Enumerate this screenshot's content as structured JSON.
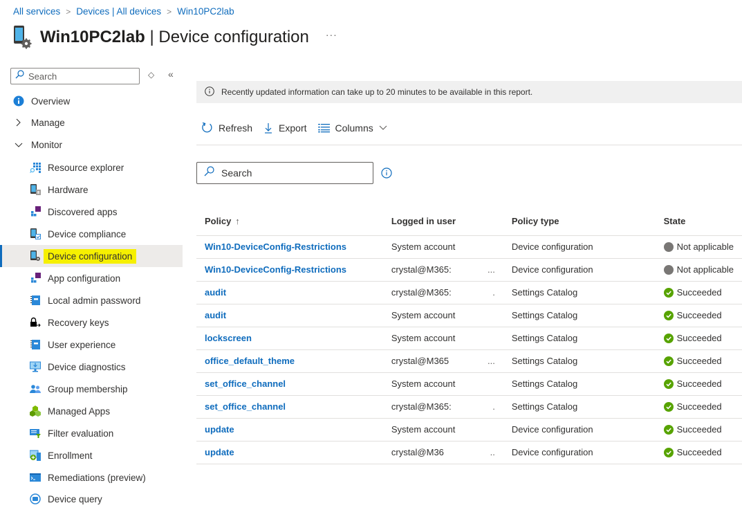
{
  "breadcrumb": [
    {
      "label": "All services"
    },
    {
      "label": "Devices | All devices"
    },
    {
      "label": "Win10PC2lab"
    }
  ],
  "header": {
    "device_name": "Win10PC2lab",
    "separator": " | ",
    "section": "Device configuration",
    "more_label": "···"
  },
  "sidebar": {
    "search_placeholder": "Search",
    "sort_icon": "◇",
    "collapse_icon": "«",
    "items": [
      {
        "label": "Overview",
        "icon": "info-icon",
        "level": "top"
      },
      {
        "label": "Manage",
        "icon": "chevron-right-icon",
        "level": "top"
      },
      {
        "label": "Monitor",
        "icon": "chevron-down-icon",
        "level": "top"
      },
      {
        "label": "Resource explorer",
        "icon": "resource-explorer-icon",
        "level": "sub"
      },
      {
        "label": "Hardware",
        "icon": "hardware-icon",
        "level": "sub"
      },
      {
        "label": "Discovered apps",
        "icon": "discovered-apps-icon",
        "level": "sub"
      },
      {
        "label": "Device compliance",
        "icon": "device-compliance-icon",
        "level": "sub"
      },
      {
        "label": "Device configuration",
        "icon": "device-configuration-icon",
        "level": "sub",
        "active": true
      },
      {
        "label": "App configuration",
        "icon": "app-configuration-icon",
        "level": "sub"
      },
      {
        "label": "Local admin password",
        "icon": "local-admin-password-icon",
        "level": "sub"
      },
      {
        "label": "Recovery keys",
        "icon": "recovery-keys-icon",
        "level": "sub"
      },
      {
        "label": "User experience",
        "icon": "user-experience-icon",
        "level": "sub"
      },
      {
        "label": "Device diagnostics",
        "icon": "device-diagnostics-icon",
        "level": "sub"
      },
      {
        "label": "Group membership",
        "icon": "group-membership-icon",
        "level": "sub"
      },
      {
        "label": "Managed Apps",
        "icon": "managed-apps-icon",
        "level": "sub"
      },
      {
        "label": "Filter evaluation",
        "icon": "filter-evaluation-icon",
        "level": "sub"
      },
      {
        "label": "Enrollment",
        "icon": "enrollment-icon",
        "level": "sub"
      },
      {
        "label": "Remediations (preview)",
        "icon": "remediations-icon",
        "level": "sub"
      },
      {
        "label": "Device query",
        "icon": "device-query-icon",
        "level": "sub"
      }
    ]
  },
  "main": {
    "info_message": "Recently updated information can take up to 20 minutes to be available in this report.",
    "toolbar": {
      "refresh_label": "Refresh",
      "export_label": "Export",
      "columns_label": "Columns"
    },
    "search_placeholder": "Search",
    "table": {
      "columns": [
        "Policy",
        "Logged in user",
        "Policy type",
        "State"
      ],
      "sort_indicator": "↑",
      "rows": [
        {
          "policy": "Win10-DeviceConfig-Restrictions",
          "user": "System account",
          "user_ellipsis": "",
          "type": "Device configuration",
          "state": "Not applicable",
          "status": "na"
        },
        {
          "policy": "Win10-DeviceConfig-Restrictions",
          "user": "crystal@M365:",
          "user_ellipsis": "...",
          "type": "Device configuration",
          "state": "Not applicable",
          "status": "na"
        },
        {
          "policy": "audit",
          "user": "crystal@M365:",
          "user_ellipsis": ".",
          "type": "Settings Catalog",
          "state": "Succeeded",
          "status": "ok"
        },
        {
          "policy": "audit",
          "user": "System account",
          "user_ellipsis": "",
          "type": "Settings Catalog",
          "state": "Succeeded",
          "status": "ok"
        },
        {
          "policy": "lockscreen",
          "user": "System account",
          "user_ellipsis": "",
          "type": "Settings Catalog",
          "state": "Succeeded",
          "status": "ok"
        },
        {
          "policy": "office_default_theme",
          "user": "crystal@M365",
          "user_ellipsis": "...",
          "type": "Settings Catalog",
          "state": "Succeeded",
          "status": "ok"
        },
        {
          "policy": "set_office_channel",
          "user": "System account",
          "user_ellipsis": "",
          "type": "Settings Catalog",
          "state": "Succeeded",
          "status": "ok"
        },
        {
          "policy": "set_office_channel",
          "user": "crystal@M365:",
          "user_ellipsis": ".",
          "type": "Settings Catalog",
          "state": "Succeeded",
          "status": "ok"
        },
        {
          "policy": "update",
          "user": "System account",
          "user_ellipsis": "",
          "type": "Device configuration",
          "state": "Succeeded",
          "status": "ok"
        },
        {
          "policy": "update",
          "user": "crystal@M36",
          "user_ellipsis": "..",
          "type": "Device configuration",
          "state": "Succeeded",
          "status": "ok"
        }
      ]
    }
  },
  "colors": {
    "link": "#0f6cbd",
    "highlight": "#f6f000",
    "succeeded": "#57a300",
    "not_applicable": "#797775",
    "active_bg": "#edebe9"
  }
}
